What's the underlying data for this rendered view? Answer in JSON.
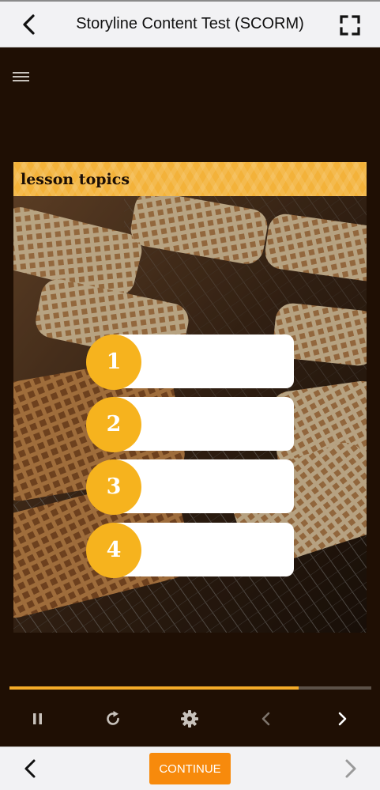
{
  "header": {
    "title": "Storyline Content Test (SCORM)"
  },
  "icons": {
    "back": "chevron-left-icon",
    "fullscreen": "fullscreen-icon",
    "menu": "hamburger-menu-icon",
    "pause": "pause-icon",
    "replay": "replay-icon",
    "settings": "gear-icon",
    "slide_prev": "chevron-left-icon",
    "slide_next": "chevron-right-icon"
  },
  "slide": {
    "heading": "lesson topics",
    "topics": [
      {
        "number": "1",
        "label": ""
      },
      {
        "number": "2",
        "label": ""
      },
      {
        "number": "3",
        "label": ""
      },
      {
        "number": "4",
        "label": ""
      }
    ]
  },
  "player": {
    "progress": 0.8
  },
  "footer": {
    "continue_label": "CONTINUE"
  },
  "colors": {
    "accent_orange": "#f78a0c",
    "topic_gold": "#f6b31e",
    "header_gold": "#f3b23a",
    "player_bg": "#1f0f04",
    "progress": "#f3ab29"
  }
}
